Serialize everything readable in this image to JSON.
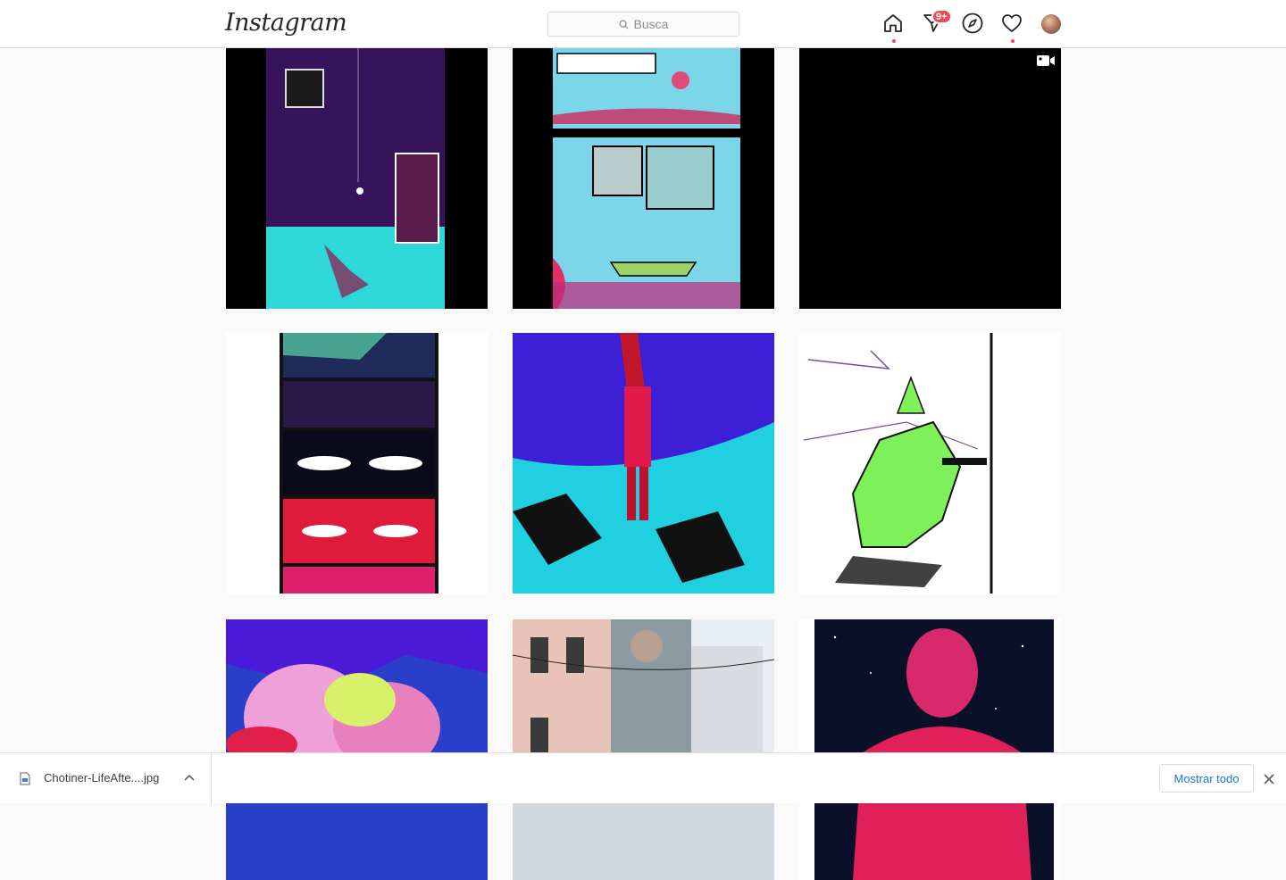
{
  "header": {
    "logo_text": "Instagram",
    "search_placeholder": "Busca",
    "direct_badge": "9+"
  },
  "posts": [
    {
      "type": "image",
      "description_icon": "comic-page"
    },
    {
      "type": "image",
      "description_icon": "comic-page"
    },
    {
      "type": "video",
      "description_icon": "video-icon"
    },
    {
      "type": "image",
      "description_icon": "comic-strip"
    },
    {
      "type": "image",
      "description_icon": "illustration"
    },
    {
      "type": "image",
      "description_icon": "sketch"
    },
    {
      "type": "image",
      "description_icon": "illustration"
    },
    {
      "type": "image",
      "description_icon": "street-mural"
    },
    {
      "type": "image",
      "description_icon": "illustration"
    }
  ],
  "download_bar": {
    "file_name": "Chotiner-LifeAfte....jpg",
    "show_all_label": "Mostrar todo"
  },
  "colors": {
    "accent_red": "#ed4956",
    "link_blue": "#1a73e8"
  }
}
